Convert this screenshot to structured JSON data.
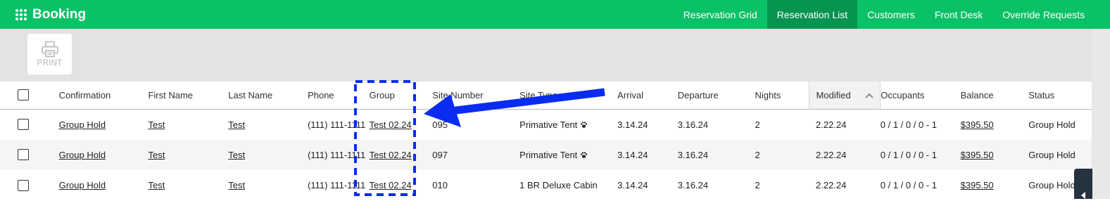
{
  "app": {
    "title": "Booking"
  },
  "nav": [
    "Reservation Grid",
    "Reservation List",
    "Customers",
    "Front Desk",
    "Override Requests"
  ],
  "nav_active": "Reservation List",
  "toolbar": {
    "print_label": "PRINT"
  },
  "table": {
    "headers": [
      "Confirmation",
      "First Name",
      "Last Name",
      "Phone",
      "Group",
      "Site Number",
      "Site Type",
      "Arrival",
      "Departure",
      "Nights",
      "Modified",
      "Occupants",
      "Balance",
      "Status"
    ],
    "sorted_column": "Modified",
    "sort_direction": "ascending",
    "rows": [
      {
        "confirmation": "Group Hold",
        "first": "Test",
        "last": "Test",
        "phone": "(111) 111-1111",
        "group": "Test 02.24",
        "site": "095",
        "site_type": "Primative Tent",
        "site_type_icon": "paw-icon",
        "arrival": "3.14.24",
        "departure": "3.16.24",
        "nights": "2",
        "modified": "2.22.24",
        "occupants": "0 / 1 / 0 / 0 - 1",
        "balance": "$395.50",
        "status": "Group Hold"
      },
      {
        "confirmation": "Group Hold",
        "first": "Test",
        "last": "Test",
        "phone": "(111) 111-1111",
        "group": "Test 02.24",
        "site": "097",
        "site_type": "Primative Tent",
        "site_type_icon": "paw-icon",
        "arrival": "3.14.24",
        "departure": "3.16.24",
        "nights": "2",
        "modified": "2.22.24",
        "occupants": "0 / 1 / 0 / 0 - 1",
        "balance": "$395.50",
        "status": "Group Hold"
      },
      {
        "confirmation": "Group Hold",
        "first": "Test",
        "last": "Test",
        "phone": "(111) 111-1111",
        "group": "Test 02.24",
        "site": "010",
        "site_type": "1 BR Deluxe Cabin",
        "site_type_icon": "",
        "arrival": "3.14.24",
        "departure": "3.16.24",
        "nights": "2",
        "modified": "2.22.24",
        "occupants": "0 / 1 / 0 / 0 - 1",
        "balance": "$395.50",
        "status": "Group Hold"
      }
    ]
  },
  "colors": {
    "brand": "#0bc167",
    "nav_active": "#079451",
    "annotation": "#0a2cf0"
  }
}
